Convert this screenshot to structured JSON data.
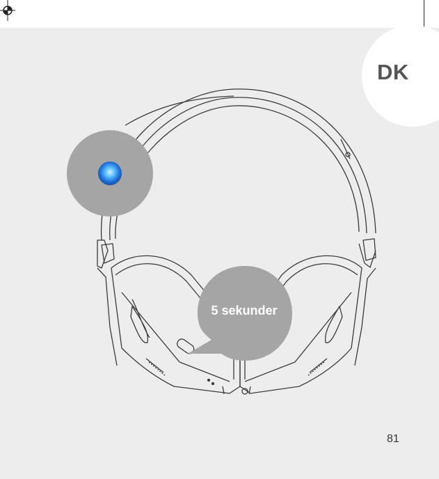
{
  "language_badge": "DK",
  "duration_label": "5 sekunder",
  "page_number": "81",
  "led_color": "#2f8bff",
  "icons": {
    "registration": "registration-mark-icon",
    "led": "led-light-icon"
  }
}
